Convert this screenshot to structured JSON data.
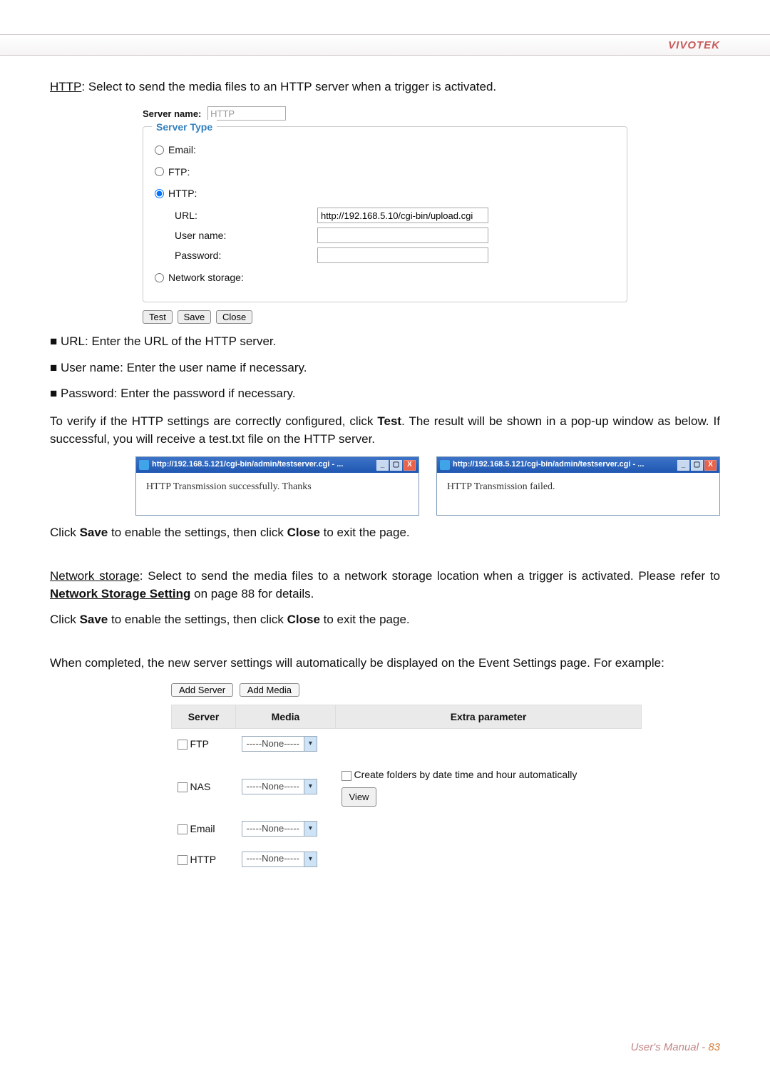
{
  "brand": "VIVOTEK",
  "intro_http_prefix": "HTTP",
  "intro_http_rest": ": Select to send the media files to an HTTP server when a trigger is activated.",
  "server_name_label": "Server name:",
  "server_name_value": "HTTP",
  "fieldset_legend": "Server Type",
  "radio_email": "Email:",
  "radio_ftp": "FTP:",
  "radio_http": "HTTP:",
  "url_label": "URL:",
  "url_value": "http://192.168.5.10/cgi-bin/upload.cgi",
  "username_label": "User name:",
  "password_label": "Password:",
  "radio_network_storage": "Network storage:",
  "btn_test": "Test",
  "btn_save": "Save",
  "btn_close": "Close",
  "bullet_url": "URL: Enter the URL of the HTTP server.",
  "bullet_username": "User name: Enter the user name if necessary.",
  "bullet_password": "Password: Enter the password if necessary.",
  "verify_text_a": "To verify if the HTTP settings are correctly configured, click ",
  "verify_text_b": "Test",
  "verify_text_c": ". The result will be shown in a pop-up window as below. If successful, you will receive a test.txt file on the HTTP server.",
  "popup_url": "http://192.168.5.121/cgi-bin/admin/testserver.cgi - ...",
  "popup_success": "HTTP Transmission successfully. Thanks",
  "popup_fail": "HTTP Transmission failed.",
  "click_save_a": "Click ",
  "click_save_b": "Save",
  "click_save_c": " to enable the settings, then click ",
  "click_save_d": "Close",
  "click_save_e": " to exit the page.",
  "ns_prefix": "Network storage",
  "ns_rest_a": ": Select to send the media files to a network storage location when a trigger is activated. Please refer to ",
  "ns_link": "Network Storage Setting",
  "ns_rest_b": " on page 88 for details.",
  "completed_text": "When completed, the new server settings will automatically be displayed on the Event Settings page. For example:",
  "add_server_btn": "Add Server",
  "add_media_btn": "Add Media",
  "th_server": "Server",
  "th_media": "Media",
  "th_extra": "Extra parameter",
  "none_option": "-----None-----",
  "row_ftp": "FTP",
  "row_nas": "NAS",
  "row_email": "Email",
  "row_http": "HTTP",
  "nas_extra_label": "Create folders by date time and hour automatically",
  "view_btn": "View",
  "footer_label": "User's Manual - ",
  "footer_page": "83"
}
